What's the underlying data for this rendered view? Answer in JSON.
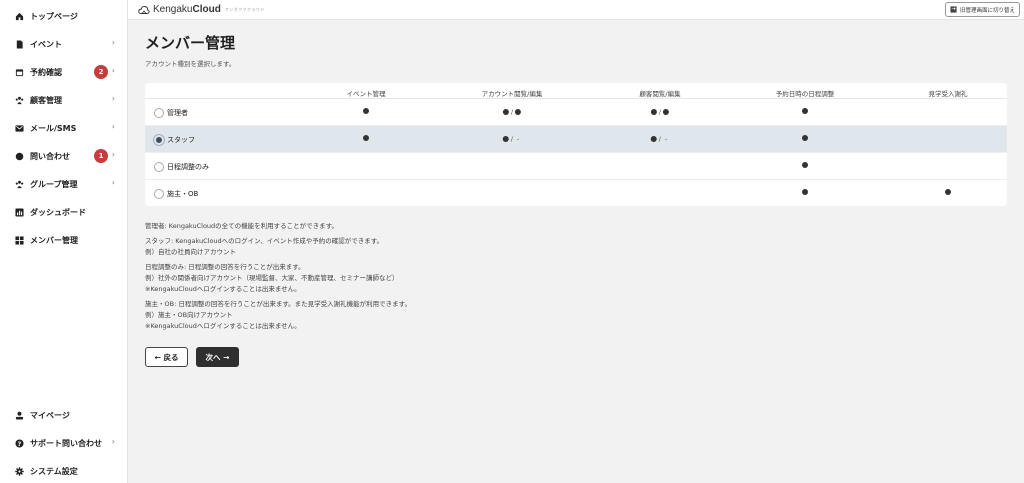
{
  "sidebar": {
    "items": [
      {
        "label": "トップページ"
      },
      {
        "label": "イベント"
      },
      {
        "label": "予約確認",
        "badge": "2"
      },
      {
        "label": "顧客管理"
      },
      {
        "label": "メール/SMS"
      },
      {
        "label": "問い合わせ",
        "badge": "1"
      },
      {
        "label": "グループ管理"
      },
      {
        "label": "ダッシュボード"
      },
      {
        "label": "メンバー管理"
      }
    ],
    "bottom": [
      {
        "label": "マイページ"
      },
      {
        "label": "サポート問い合わせ"
      },
      {
        "label": "システム設定"
      }
    ]
  },
  "header": {
    "logo_light": "Kengaku",
    "logo_bold": "Cloud",
    "logo_sub": "ケンガクククラウド",
    "switch_label": "旧管理画面に切り替え"
  },
  "page": {
    "title": "メンバー管理",
    "subtitle": "アカウント種別を選択します。"
  },
  "table": {
    "columns": [
      "イベント管理",
      "アカウント閲覧/編集",
      "顧客閲覧/編集",
      "予約日時の日程調整",
      "見学受入謝礼"
    ],
    "rows": [
      {
        "label": "管理者",
        "c1": "●",
        "c2a": "●",
        "c2sep": "/",
        "c2b": "●",
        "c3a": "●",
        "c3sep": "/",
        "c3b": "●",
        "c4": "●",
        "c5": ""
      },
      {
        "label": "スタッフ",
        "c1": "●",
        "c2a": "●",
        "c2sep": "/",
        "c2b": "-",
        "c3a": "●",
        "c3sep": "/",
        "c3b": "-",
        "c4": "●",
        "c5": ""
      },
      {
        "label": "日程調整のみ",
        "c1": "",
        "c2a": "",
        "c2sep": "",
        "c2b": "",
        "c3a": "",
        "c3sep": "",
        "c3b": "",
        "c4": "●",
        "c5": ""
      },
      {
        "label": "施主・OB",
        "c1": "",
        "c2a": "",
        "c2sep": "",
        "c2b": "",
        "c3a": "",
        "c3sep": "",
        "c3b": "",
        "c4": "●",
        "c5": "●"
      }
    ],
    "selected_row": "スタッフ"
  },
  "description": {
    "admin": "管理者: KengakuCloudの全ての機能を利用することができます。",
    "staff_1": "スタッフ: KengakuCloudへのログイン、イベント作成や予約の確認ができます。",
    "staff_2": "例）自社の社員向けアカウント",
    "sched_1": "日程調整のみ: 日程調整の回答を行うことが出来ます。",
    "sched_2": "例）社外の関係者向けアカウント（現場監督、大家、不動産管理、セミナー講師など）",
    "sched_3": "※KengakuCloudへログインすることは出来ません。",
    "owner_1": "施主・OB: 日程調整の回答を行うことが出来ます。また見学受入謝礼機能が利用できます。",
    "owner_2": "例）施主・OB向けアカウント",
    "owner_3": "※KengakuCloudへログインすることは出来ません。"
  },
  "buttons": {
    "back": "← 戻る",
    "next": "次へ →"
  },
  "colors": {
    "badge": "#c63d3d",
    "selected_row": "#dfe6ec",
    "primary_button": "#2f2f2f"
  },
  "icons": {
    "sidebar": [
      "home-icon",
      "document-icon",
      "calendar-icon",
      "people-icon",
      "mail-icon",
      "chat-icon",
      "group-icon",
      "dashboard-icon",
      "members-icon"
    ],
    "bottom": [
      "user-icon",
      "help-icon",
      "gear-icon"
    ]
  }
}
